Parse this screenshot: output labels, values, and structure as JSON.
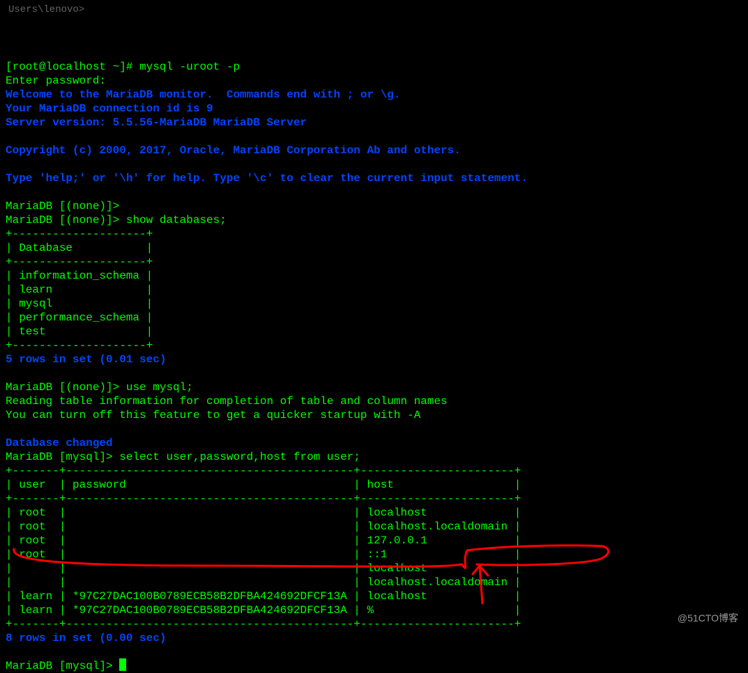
{
  "faded_path": "Users\\lenovo>",
  "shell_prompt": "[root@localhost ~]# ",
  "shell_cmd": "mysql -uroot -p",
  "enter_password": "Enter password:",
  "welcome1": "Welcome to the MariaDB monitor.  Commands end with ; or \\g.",
  "welcome2": "Your MariaDB connection id is 9",
  "welcome3": "Server version: 5.5.56-MariaDB MariaDB Server",
  "copyright": "Copyright (c) 2000, 2017, Oracle, MariaDB Corporation Ab and others.",
  "help_line": "Type 'help;' or '\\h' for help. Type '\\c' to clear the current input statement.",
  "p_none": "MariaDB [(none)]>",
  "cmd_show_db": " show databases;",
  "db_border_top": "+--------------------+",
  "db_header": "| Database           |",
  "db_rows": [
    "| information_schema |",
    "| learn              |",
    "| mysql              |",
    "| performance_schema |",
    "| test               |"
  ],
  "db_rows_result": "5 rows in set (0.01 sec)",
  "cmd_use_mysql": " use mysql;",
  "reading1": "Reading table information for completion of table and column names",
  "reading2": "You can turn off this feature to get a quicker startup with -A",
  "db_changed": "Database changed",
  "p_mysql": "MariaDB [mysql]>",
  "cmd_select": " select user,password,host from user;",
  "ut_border": "+-------+-------------------------------------------+-----------------------+",
  "ut_header": "| user  | password                                  | host                  |",
  "ut_rows": [
    "| root  |                                           | localhost             |",
    "| root  |                                           | localhost.localdomain |",
    "| root  |                                           | 127.0.0.1             |",
    "| root  |                                           | ::1                   |",
    "|       |                                           | localhost             |",
    "|       |                                           | localhost.localdomain |",
    "| learn | *97C27DAC100B0789ECB58B2DFBA424692DFCF13A | localhost             |",
    "| learn | *97C27DAC100B0789ECB58B2DFBA424692DFCF13A | %                     |"
  ],
  "ut_result": "8 rows in set (0.00 sec)",
  "watermark": "@51CTO博客"
}
